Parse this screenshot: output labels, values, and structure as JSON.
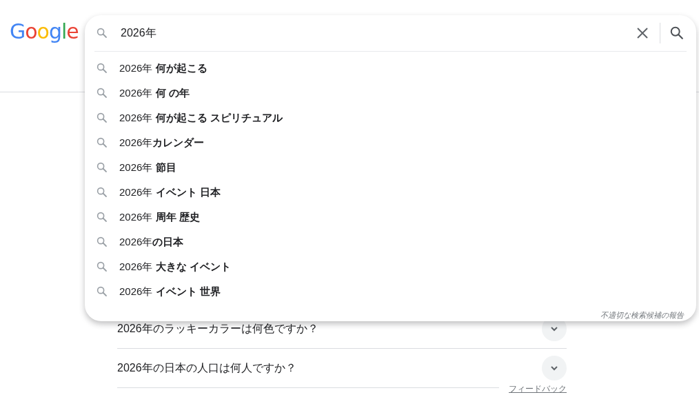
{
  "logo": "Google",
  "search": {
    "value": "2026年"
  },
  "suggestions": [
    "2026年 **何が起こる**",
    "2026年 **何 の年**",
    "2026年 **何が起こる スピリチュアル**",
    "2026年**カレンダー**",
    "2026年 **節目**",
    "2026年 **イベント 日本**",
    "2026年 **周年 歴史**",
    "2026年**の日本**",
    "2026年 **大きな イベント**",
    "2026年 **イベント 世界**"
  ],
  "report_link": "不適切な検索候補の報告",
  "questions": [
    {
      "text": "2026年のラッキーカラーは何色ですか？",
      "expanded": false
    },
    {
      "text": "2026年の日本の人口は何人ですか？",
      "expanded": false
    }
  ],
  "feedback": "フィードバック"
}
